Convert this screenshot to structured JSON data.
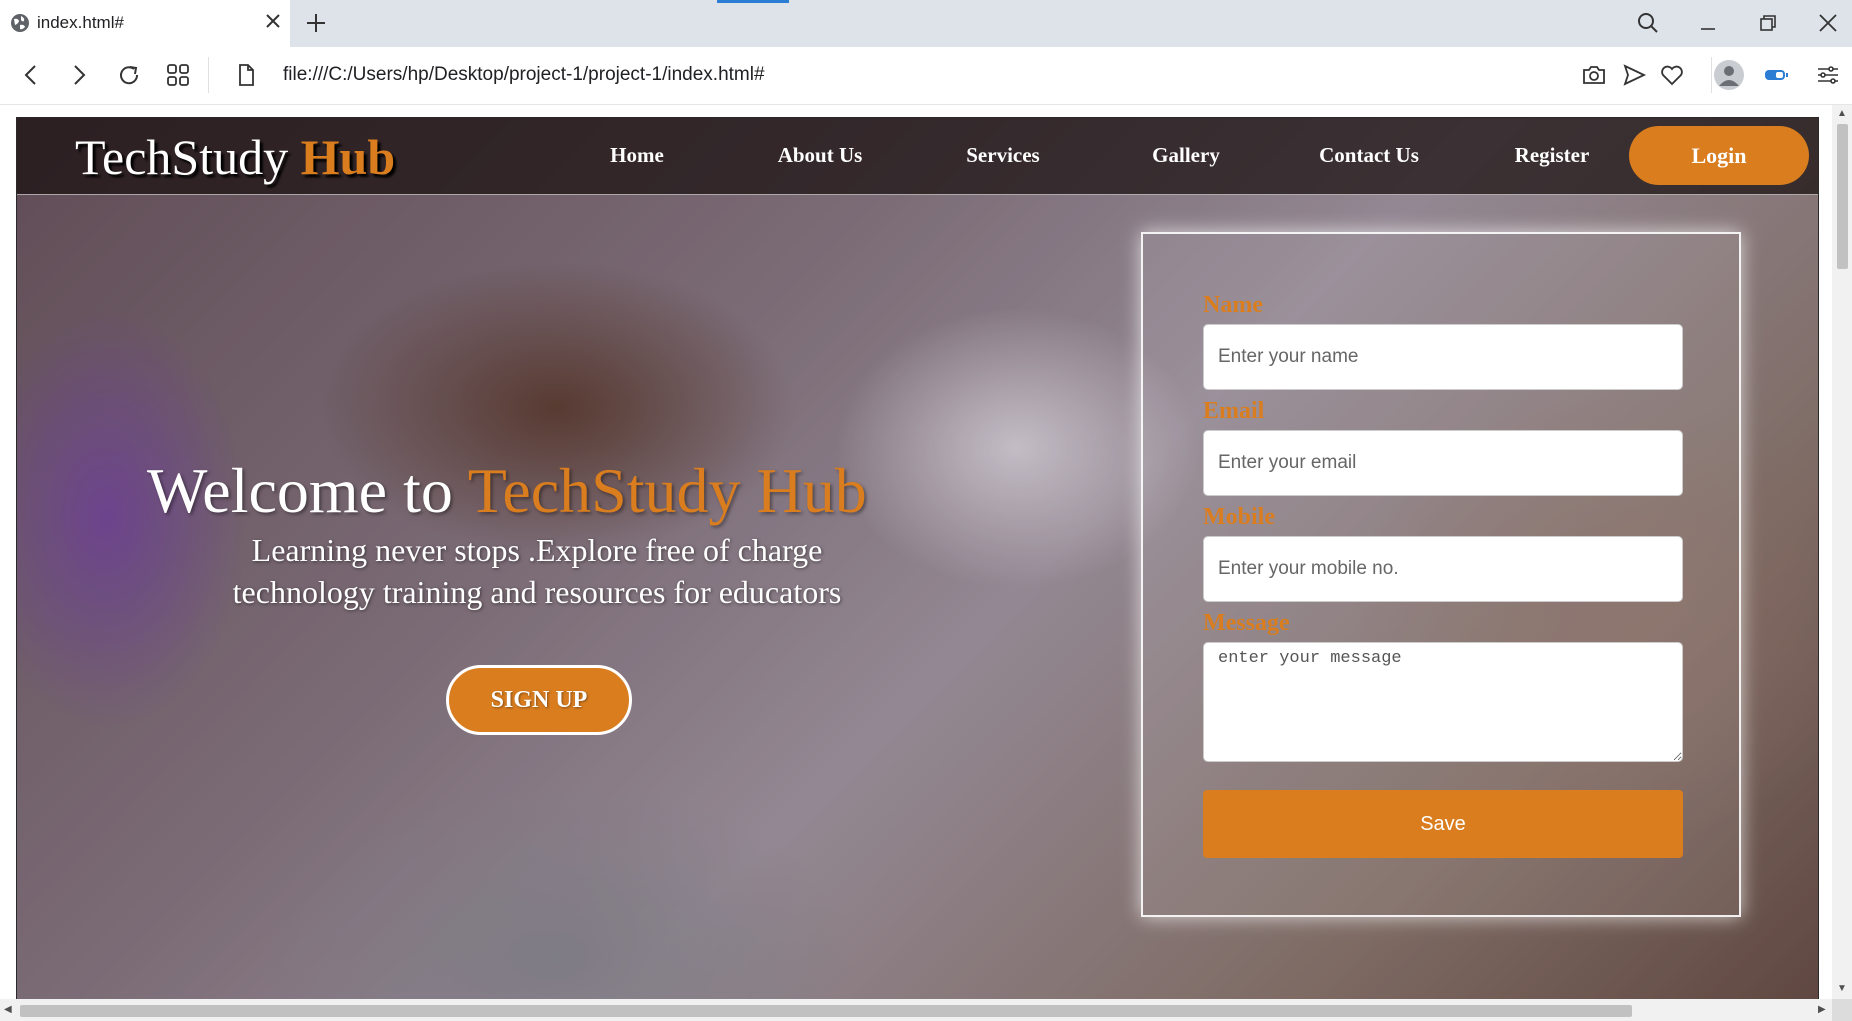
{
  "browser": {
    "tab_title": "index.html#",
    "address": "file:///C:/Users/hp/Desktop/project-1/project-1/index.html#"
  },
  "site": {
    "logo_main": "TechStudy",
    "logo_accent": "Hub",
    "nav": [
      "Home",
      "About Us",
      "Services",
      "Gallery",
      "Contact Us",
      "Register"
    ],
    "login_label": "Login"
  },
  "hero": {
    "title_main": "Welcome to",
    "title_accent": "TechStudy Hub",
    "subtitle": "Learning never stops .Explore free of charge technology training and resources for educators",
    "signup_label": "SIGN UP"
  },
  "form": {
    "name_label": "Name",
    "name_placeholder": "Enter your name",
    "email_label": "Email",
    "email_placeholder": "Enter your email",
    "mobile_label": "Mobile",
    "mobile_placeholder": "Enter your mobile no.",
    "message_label": "Message",
    "message_placeholder": "enter your message",
    "save_label": "Save"
  },
  "colors": {
    "accent": "#d97d1f",
    "nav_bg": "#19100f",
    "tabbar_bg": "#dee3ea"
  }
}
